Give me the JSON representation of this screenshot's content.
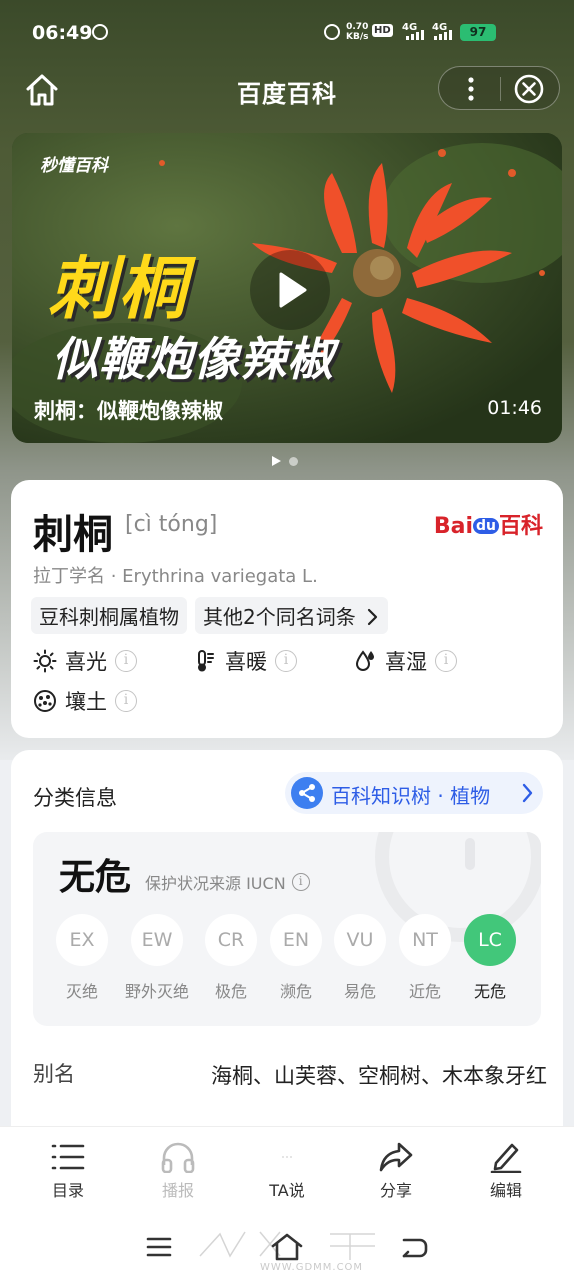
{
  "status_bar": {
    "time": "06:49",
    "net_speed_value": "0.70",
    "net_speed_unit": "KB/s",
    "hd": "HD",
    "signal1": "4G",
    "signal2": "4G",
    "battery": "97"
  },
  "nav": {
    "title": "百度百科"
  },
  "video": {
    "brand": "秒懂百科",
    "overlay_title": "刺桐",
    "overlay_subtitle": "似鞭炮像辣椒",
    "caption": "刺桐：似鞭炮像辣椒",
    "duration": "01:46",
    "carousel_pages": 2,
    "carousel_active": 1
  },
  "entry": {
    "title": "刺桐",
    "pinyin": "[cì tóng]",
    "logo_text_1": "Bai",
    "logo_text_2": "du",
    "logo_text_3": "百科",
    "latin_name": "拉丁学名 · Erythrina variegata L.",
    "tags": [
      "豆科刺桐属植物",
      "其他2个同名词条"
    ],
    "attributes": [
      {
        "label": "喜光",
        "icon": "sun-icon"
      },
      {
        "label": "喜暖",
        "icon": "thermometer-icon"
      },
      {
        "label": "喜湿",
        "icon": "water-drop-icon"
      },
      {
        "label": "壤土",
        "icon": "soil-icon"
      }
    ],
    "info_glyph": "i"
  },
  "classification": {
    "title": "分类信息",
    "tree_button": "百科知识树 · 植物",
    "status": "无危",
    "source": "保护状况来源 IUCN",
    "levels": [
      {
        "code": "EX",
        "label": "灭绝"
      },
      {
        "code": "EW",
        "label": "野外灭绝"
      },
      {
        "code": "CR",
        "label": "极危"
      },
      {
        "code": "EN",
        "label": "濒危"
      },
      {
        "code": "VU",
        "label": "易危"
      },
      {
        "code": "NT",
        "label": "近危"
      },
      {
        "code": "LC",
        "label": "无危"
      }
    ],
    "active_level": "LC",
    "alias_label": "别名",
    "alias_value": "海桐、山芙蓉、空桐树、木本象牙红"
  },
  "toolbar": {
    "items": [
      {
        "label": "目录",
        "icon": "list-icon",
        "enabled": true
      },
      {
        "label": "播报",
        "icon": "headphones-icon",
        "enabled": false
      },
      {
        "label": "TA说",
        "icon": "comment-icon",
        "enabled": true
      },
      {
        "label": "分享",
        "icon": "share-icon",
        "enabled": true
      },
      {
        "label": "编辑",
        "icon": "edit-icon",
        "enabled": true
      }
    ]
  },
  "watermark": {
    "text": "WWW.GDMM.COM"
  },
  "colors": {
    "accent_blue": "#2e5de6",
    "lc_green": "#42c77a",
    "baidu_red": "#d8232a",
    "title_yellow": "#ffd91a"
  }
}
